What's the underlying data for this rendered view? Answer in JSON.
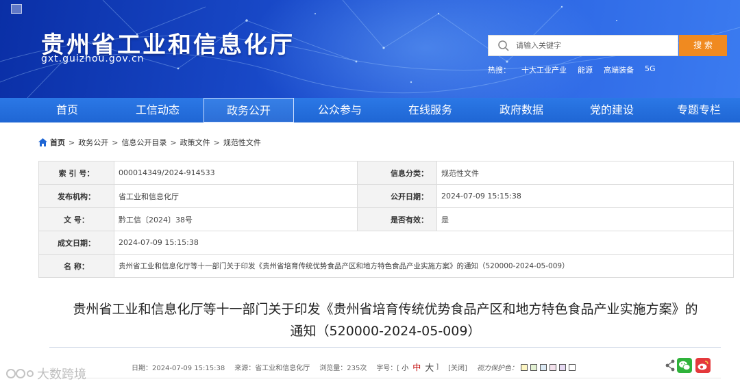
{
  "header": {
    "title": "贵州省工业和信息化厅",
    "domain": "gxt.guizhou.gov.cn",
    "search": {
      "placeholder": "请输入关键字",
      "button": "搜 索"
    },
    "hot": [
      "热搜：",
      "十大工业产业",
      "能源",
      "高端装备",
      "5G"
    ]
  },
  "nav": [
    "首页",
    "工信动态",
    "政务公开",
    "公众参与",
    "在线服务",
    "政府数据",
    "党的建设",
    "专题专栏"
  ],
  "nav_active_index": 2,
  "breadcrumb": [
    "首页",
    "政务公开",
    "信息公开目录",
    "政策文件",
    "规范性文件"
  ],
  "info": {
    "index_label": "索 引 号：",
    "index_value": "000014349/2024-914533",
    "category_label": "信息分类：",
    "category_value": "规范性文件",
    "org_label": "发布机构：",
    "org_value": "省工业和信息化厅",
    "pubdate_label": "公开日期：",
    "pubdate_value": "2024-07-09 15:15:38",
    "docno_label": "文 号：",
    "docno_value": "黔工信〔2024〕38号",
    "valid_label": "是否有效：",
    "valid_value": "是",
    "date_label": "成文日期：",
    "date_value": "2024-07-09 15:15:38",
    "name_label": "名 称：",
    "name_value": "贵州省工业和信息化厅等十一部门关于印发《贵州省培育传统优势食品产区和地方特色食品产业实施方案》的通知（520000-2024-05-009）"
  },
  "article": {
    "title_line1": "贵州省工业和信息化厅等十一部门关于印发《贵州省培育传统优势食品产区和地方特色食品产业实施方案》的",
    "title_line2": "通知（520000-2024-05-009）",
    "meta": {
      "date": "日期：2024-07-09 15:15:38",
      "source": "来源：省工业和信息化厅",
      "views": "浏览量：235次",
      "fontsize_label": "字号：[",
      "fs_small": "小",
      "fs_medium": "中",
      "fs_large": "大",
      "fontsize_end": "]",
      "close": "[关闭]",
      "eye_label": "视力保护色：",
      "eye_colors": [
        "#fdf6c3",
        "#e3f1d3",
        "#dbe9f4",
        "#f3e1ec",
        "#e6d9f2",
        "#ffffff"
      ]
    }
  },
  "watermark": "大数跨境",
  "colors": {
    "primary": "#1f66d4",
    "search_button": "#f08a20",
    "font_medium": "#c00000"
  }
}
